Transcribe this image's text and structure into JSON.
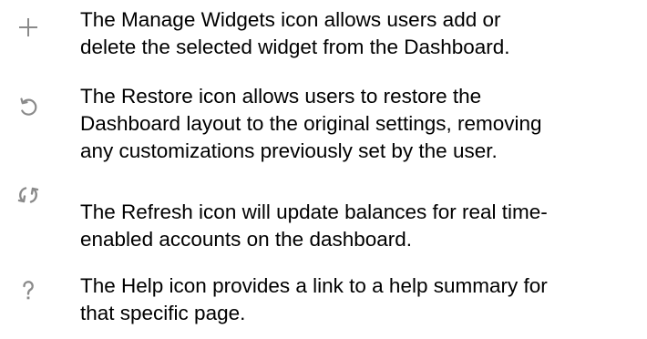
{
  "items": [
    {
      "icon": "plus-icon",
      "lines": [
        "The Manage Widgets icon allows users add or",
        "delete the selected widget from the Dashboard."
      ]
    },
    {
      "icon": "restore-icon",
      "lines": [
        "The Restore icon allows users to restore the",
        "Dashboard layout to the original settings, removing",
        "any customizations previously set by the user."
      ]
    },
    {
      "icon": "refresh-icon",
      "lines": [
        "The Refresh icon will update balances for real time-",
        "enabled accounts on the dashboard."
      ]
    },
    {
      "icon": "help-icon",
      "lines": [
        "The Help icon provides a link to a help summary for",
        "that specific page."
      ]
    }
  ],
  "colors": {
    "icon": "#8a8a8a",
    "text": "#000000"
  }
}
